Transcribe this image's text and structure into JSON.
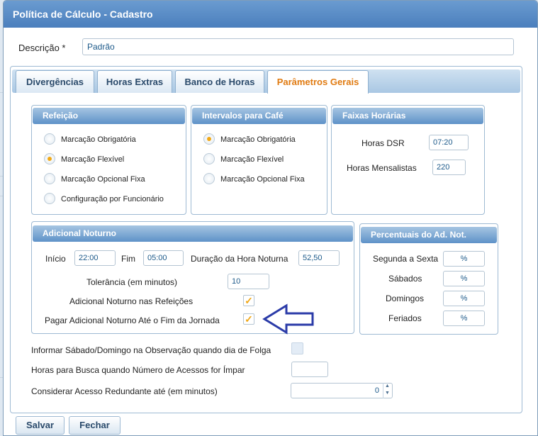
{
  "window": {
    "title": "Política de Cálculo - Cadastro"
  },
  "descricao": {
    "label": "Descrição *",
    "value": "Padrão"
  },
  "tabs": [
    {
      "label": "Divergências"
    },
    {
      "label": "Horas Extras"
    },
    {
      "label": "Banco de Horas"
    },
    {
      "label": "Parâmetros Gerais"
    }
  ],
  "active_tab": "Parâmetros Gerais",
  "refeicao": {
    "title": "Refeição",
    "options": [
      {
        "label": "Marcação Obrigatória",
        "selected": false
      },
      {
        "label": "Marcação Flexível",
        "selected": true
      },
      {
        "label": "Marcação Opcional Fixa",
        "selected": false
      },
      {
        "label": "Configuração por Funcionário",
        "selected": false
      }
    ]
  },
  "intervalos": {
    "title": "Intervalos para Café",
    "options": [
      {
        "label": "Marcação Obrigatória",
        "selected": true
      },
      {
        "label": "Marcação Flexível",
        "selected": false
      },
      {
        "label": "Marcação Opcional Fixa",
        "selected": false
      }
    ]
  },
  "faixas": {
    "title": "Faixas Horárias",
    "horas_dsr_label": "Horas DSR",
    "horas_dsr_value": "07:20",
    "horas_mensalistas_label": "Horas Mensalistas",
    "horas_mensalistas_value": "220"
  },
  "adicional": {
    "title": "Adicional Noturno",
    "inicio_label": "Início",
    "inicio_value": "22:00",
    "fim_label": "Fim",
    "fim_value": "05:00",
    "duracao_label": "Duração da Hora Noturna",
    "duracao_value": "52,50",
    "tolerancia_label": "Tolerância (em minutos)",
    "tolerancia_value": "10",
    "refeicoes_label": "Adicional Noturno nas Refeições",
    "refeicoes_checked": true,
    "pagar_label": "Pagar Adicional Noturno Até o Fim da Jornada",
    "pagar_checked": true
  },
  "percentuais": {
    "title": "Percentuais do Ad. Not.",
    "rows": [
      {
        "label": "Segunda a Sexta",
        "value": "%"
      },
      {
        "label": "Sábados",
        "value": "%"
      },
      {
        "label": "Domingos",
        "value": "%"
      },
      {
        "label": "Feriados",
        "value": "%"
      }
    ]
  },
  "extras": {
    "informar_label": "Informar Sábado/Domingo na Observação quando dia de Folga",
    "informar_checked": false,
    "horas_busca_label": "Horas para Busca quando Número de Acessos for Ímpar",
    "horas_busca_value": "",
    "redundante_label": "Considerar Acesso Redundante até (em minutos)",
    "redundante_value": "0"
  },
  "buttons": {
    "salvar": "Salvar",
    "fechar": "Fechar"
  },
  "colors": {
    "accent_tab": "#e07a10",
    "header_blue": "#4b7fbd",
    "arrow": "#2b3ba8",
    "check": "#f0a818"
  }
}
